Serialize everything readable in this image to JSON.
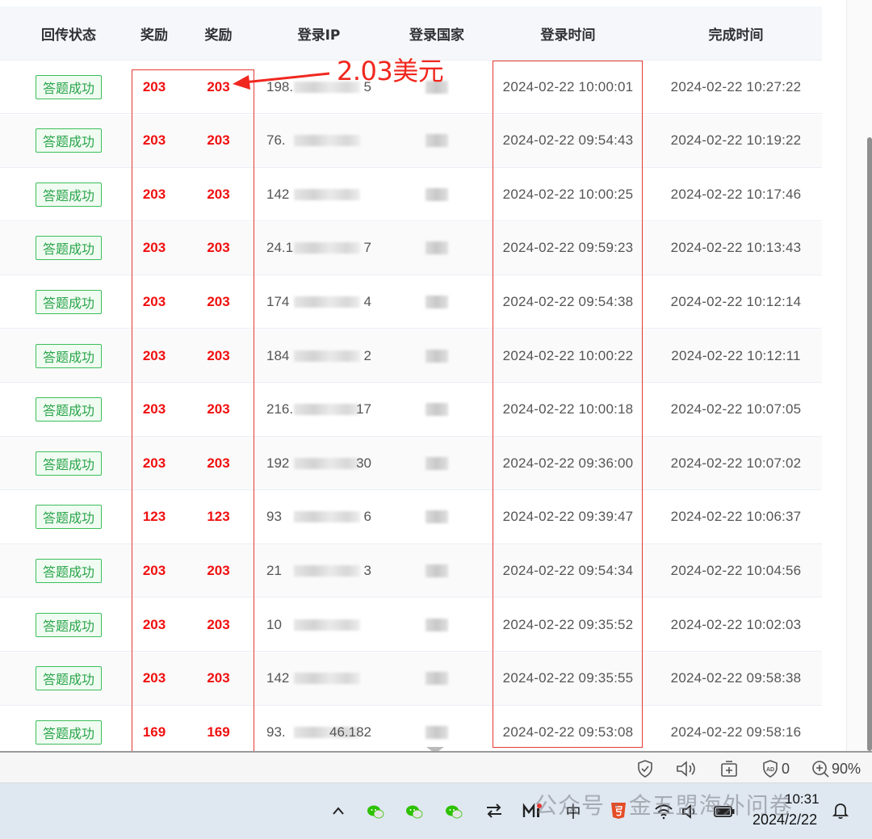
{
  "table": {
    "headers": {
      "status": "回传状态",
      "reward1": "奖励",
      "reward2": "奖励",
      "ip": "登录IP",
      "country": "登录国家",
      "login_time": "登录时间",
      "complete_time": "完成时间"
    },
    "rows": [
      {
        "status": "答题成功",
        "reward1": "203",
        "reward2": "203",
        "ip_prefix": "198.",
        "ip_suffix": "5",
        "login_time": "2024-02-22 10:00:01",
        "complete_time": "2024-02-22 10:27:22"
      },
      {
        "status": "答题成功",
        "reward1": "203",
        "reward2": "203",
        "ip_prefix": "76.",
        "ip_suffix": "",
        "login_time": "2024-02-22 09:54:43",
        "complete_time": "2024-02-22 10:19:22"
      },
      {
        "status": "答题成功",
        "reward1": "203",
        "reward2": "203",
        "ip_prefix": "142",
        "ip_suffix": "",
        "login_time": "2024-02-22 10:00:25",
        "complete_time": "2024-02-22 10:17:46"
      },
      {
        "status": "答题成功",
        "reward1": "203",
        "reward2": "203",
        "ip_prefix": "24.1",
        "ip_suffix": "7",
        "login_time": "2024-02-22 09:59:23",
        "complete_time": "2024-02-22 10:13:43"
      },
      {
        "status": "答题成功",
        "reward1": "203",
        "reward2": "203",
        "ip_prefix": "174",
        "ip_suffix": "4",
        "login_time": "2024-02-22 09:54:38",
        "complete_time": "2024-02-22 10:12:14"
      },
      {
        "status": "答题成功",
        "reward1": "203",
        "reward2": "203",
        "ip_prefix": "184",
        "ip_suffix": "2",
        "login_time": "2024-02-22 10:00:22",
        "complete_time": "2024-02-22 10:12:11"
      },
      {
        "status": "答题成功",
        "reward1": "203",
        "reward2": "203",
        "ip_prefix": "216.",
        "ip_suffix": "17",
        "login_time": "2024-02-22 10:00:18",
        "complete_time": "2024-02-22 10:07:05"
      },
      {
        "status": "答题成功",
        "reward1": "203",
        "reward2": "203",
        "ip_prefix": "192",
        "ip_suffix": "30",
        "login_time": "2024-02-22 09:36:00",
        "complete_time": "2024-02-22 10:07:02"
      },
      {
        "status": "答题成功",
        "reward1": "123",
        "reward2": "123",
        "ip_prefix": "93",
        "ip_suffix": "6",
        "login_time": "2024-02-22 09:39:47",
        "complete_time": "2024-02-22 10:06:37"
      },
      {
        "status": "答题成功",
        "reward1": "203",
        "reward2": "203",
        "ip_prefix": "21",
        "ip_suffix": "3",
        "login_time": "2024-02-22 09:54:34",
        "complete_time": "2024-02-22 10:04:56"
      },
      {
        "status": "答题成功",
        "reward1": "203",
        "reward2": "203",
        "ip_prefix": "10",
        "ip_suffix": "",
        "login_time": "2024-02-22 09:35:52",
        "complete_time": "2024-02-22 10:02:03"
      },
      {
        "status": "答题成功",
        "reward1": "203",
        "reward2": "203",
        "ip_prefix": "142",
        "ip_suffix": "",
        "login_time": "2024-02-22 09:35:55",
        "complete_time": "2024-02-22 09:58:38"
      },
      {
        "status": "答题成功",
        "reward1": "169",
        "reward2": "169",
        "ip_prefix": "93.",
        "ip_suffix": "46.182",
        "login_time": "2024-02-22 09:53:08",
        "complete_time": "2024-02-22 09:58:16"
      }
    ]
  },
  "annotation": {
    "text": "2.03美元",
    "color": "#f0271f"
  },
  "statusbar": {
    "ad_count": "0",
    "zoom": "90%"
  },
  "taskbar": {
    "ime": "中",
    "time": "10:31",
    "date": "2024/2/22",
    "watermark": "公众号 · 金五盟海外问卷"
  },
  "colors": {
    "reward": "#f00f0f",
    "success_tag": "#3cbf5a",
    "highlight_box": "#e53935"
  }
}
